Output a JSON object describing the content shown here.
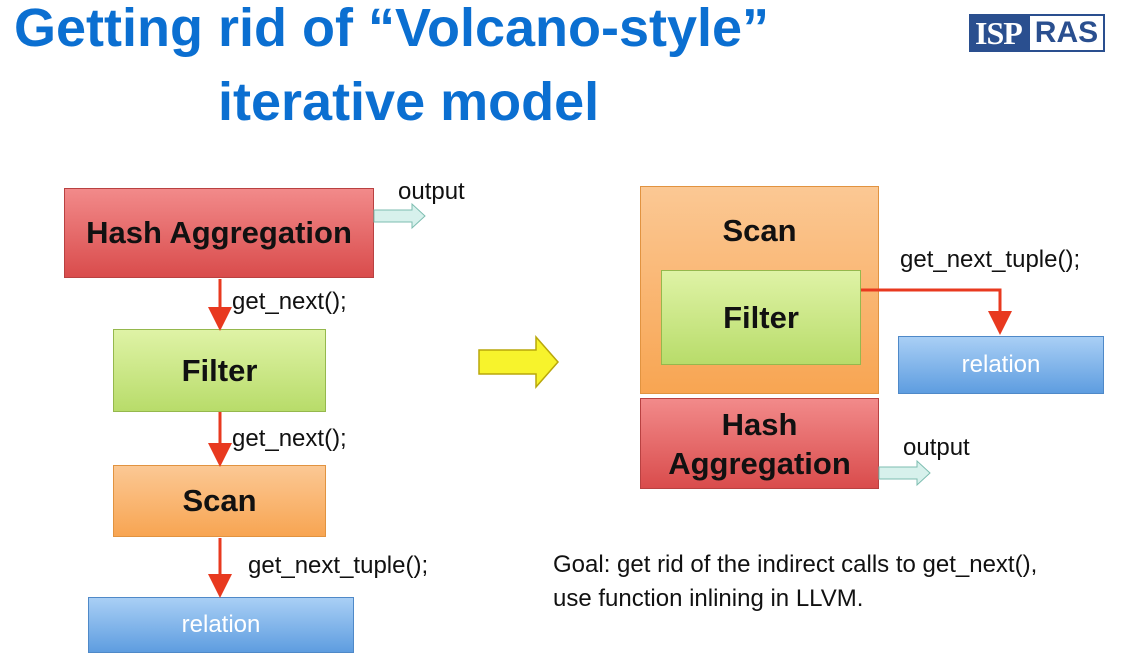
{
  "slide": {
    "title_line1": "Getting rid of “Volcano-style”",
    "title_line2": "iterative model"
  },
  "logo": {
    "left": "ISP",
    "right": "RAS"
  },
  "left_diagram": {
    "hash_aggregation": "Hash Aggregation",
    "filter": "Filter",
    "scan": "Scan",
    "relation": "relation",
    "output_label": "output",
    "call1": "get_next();",
    "call2": "get_next();",
    "call3": "get_next_tuple();"
  },
  "right_diagram": {
    "scan": "Scan",
    "filter": "Filter",
    "hash_aggregation_line1": "Hash",
    "hash_aggregation_line2": "Aggregation",
    "relation": "relation",
    "output_label": "output",
    "call": "get_next_tuple();"
  },
  "goal": {
    "line1": "Goal: get rid of the indirect calls to get_next(),",
    "line2": "use function inlining in LLVM."
  },
  "colors": {
    "title": "#0b6fd1",
    "arrow_red": "#e8391f",
    "transition_arrow": "#f7f32c",
    "output_arrow": "#d7f1ec"
  }
}
